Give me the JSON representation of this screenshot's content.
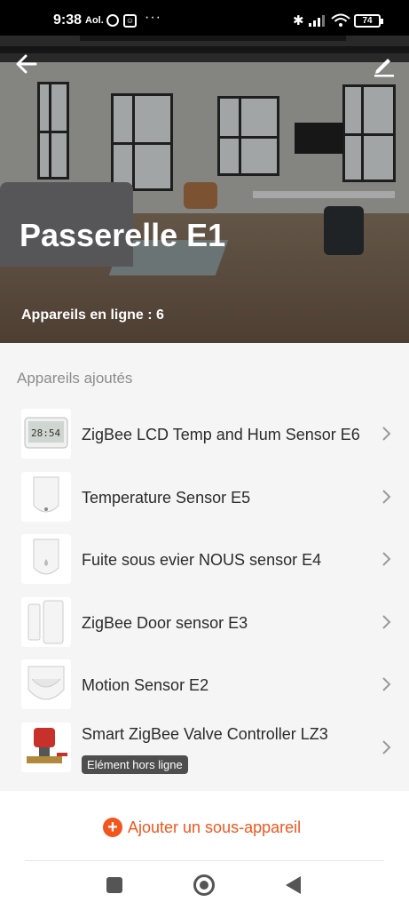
{
  "status_bar": {
    "time": "9:38",
    "brand": "Aol.",
    "dots": "···",
    "battery": "74"
  },
  "header": {
    "title": "Passerelle E1",
    "online_devices": "Appareils en ligne : 6",
    "back_icon": "arrow-left-icon",
    "edit_icon": "pencil-icon"
  },
  "devices_section": {
    "label": "Appareils ajoutés",
    "items": [
      {
        "name": "ZigBee LCD Temp and Hum Sensor E6",
        "thumb": "lcd-sensor",
        "badge": ""
      },
      {
        "name": "Temperature Sensor E5",
        "thumb": "temp-sensor",
        "badge": ""
      },
      {
        "name": "Fuite sous evier NOUS sensor E4",
        "thumb": "leak-sensor",
        "badge": ""
      },
      {
        "name": "ZigBee Door sensor E3",
        "thumb": "door-sensor",
        "badge": ""
      },
      {
        "name": "Motion Sensor E2",
        "thumb": "motion-sensor",
        "badge": ""
      },
      {
        "name": "Smart ZigBee Valve Controller LZ3",
        "thumb": "valve-controller",
        "badge": "Elément hors ligne"
      }
    ]
  },
  "footer": {
    "add_label": "Ajouter un sous-appareil",
    "add_icon": "plus-circle-icon"
  },
  "colors": {
    "accent": "#f2561d",
    "badge_bg": "#4e4e4e",
    "muted_text": "#8c8c8c"
  }
}
